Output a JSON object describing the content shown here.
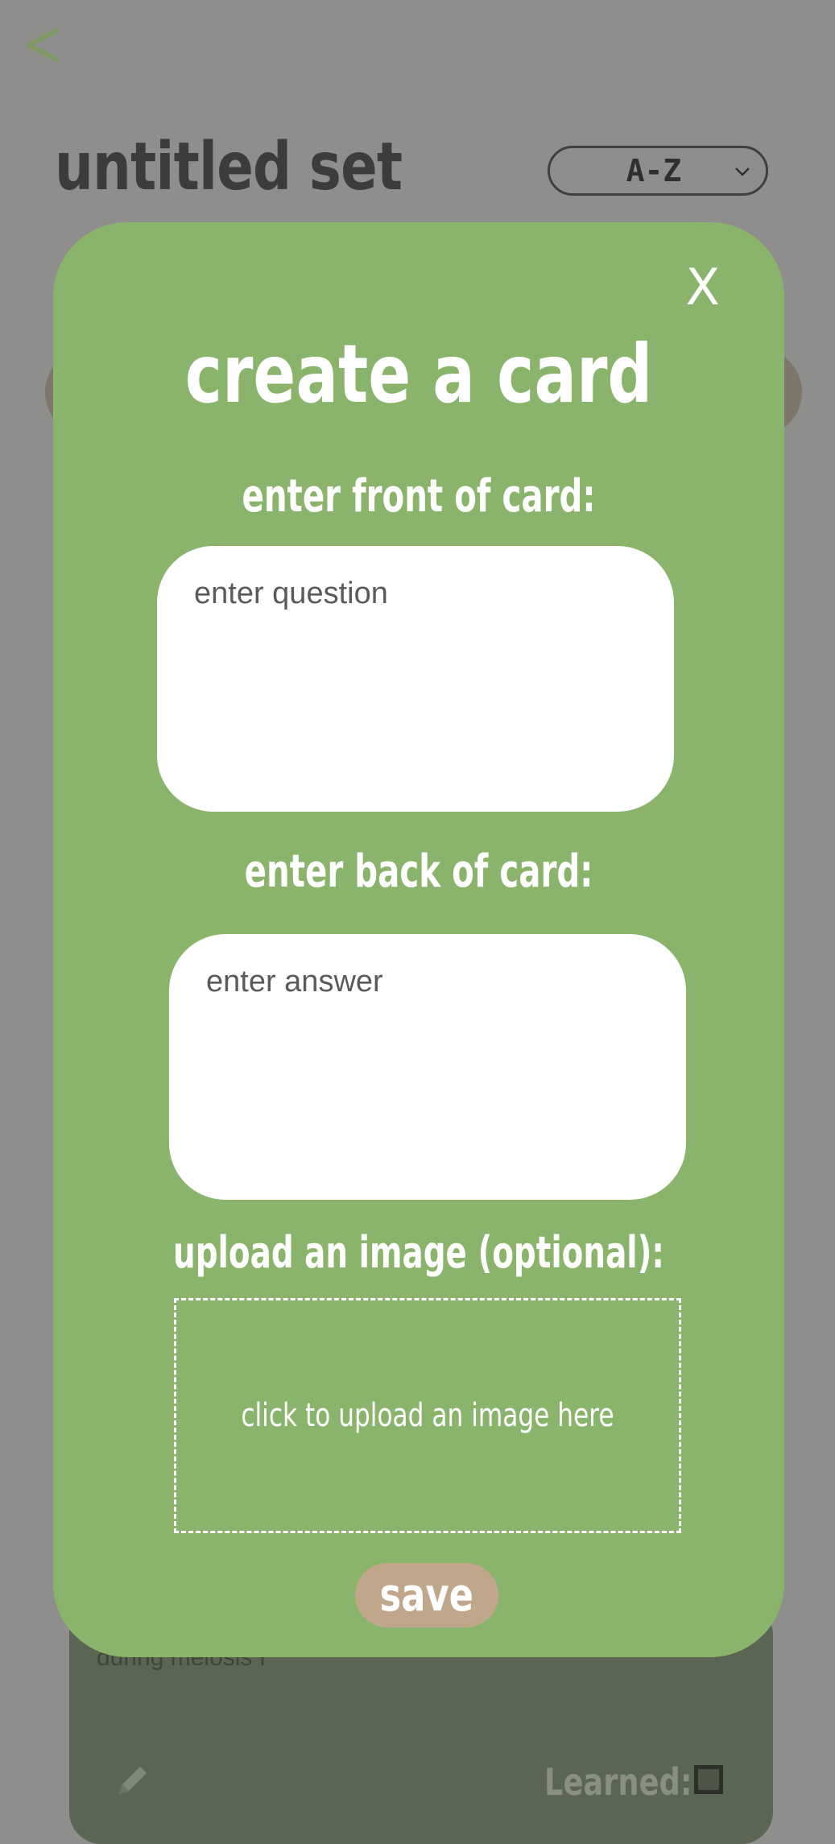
{
  "header": {
    "back_icon": "chevron-left-icon",
    "title": "untitled set",
    "sort": {
      "selected": "A-Z",
      "caret_icon": "chevron-down-icon"
    }
  },
  "background_card": {
    "text": "during meiosis I",
    "edit_icon": "pencil-icon",
    "learned_label": "Learned:"
  },
  "modal": {
    "close_label": "X",
    "title": "create a card",
    "front": {
      "label": "enter front of card:",
      "placeholder": "enter question",
      "value": ""
    },
    "back": {
      "label": "enter back of card:",
      "placeholder": "enter answer",
      "value": ""
    },
    "image": {
      "label": "upload an image (optional):",
      "prompt": "click to upload an image here"
    },
    "save_label": "save"
  },
  "colors": {
    "overlay": "#8e8e8c",
    "modal": "#8ab46c",
    "save_button": "#c0a68a",
    "accent_chevron": "#7e9a62"
  }
}
